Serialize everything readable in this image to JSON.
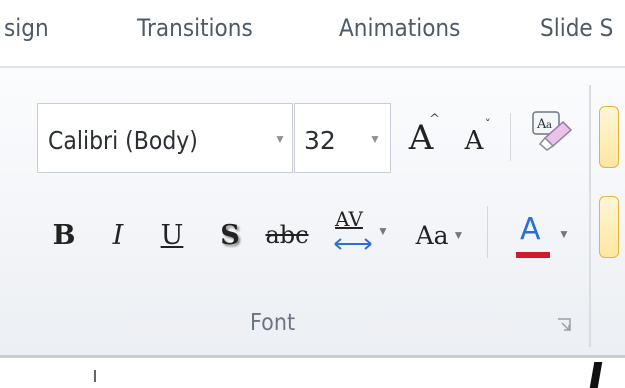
{
  "tabs": [
    {
      "label": "sign"
    },
    {
      "label": "Transitions"
    },
    {
      "label": "Animations"
    },
    {
      "label": "Slide S"
    }
  ],
  "font_group": {
    "font_name": "Calibri (Body)",
    "font_size": "32",
    "grow_label": "A",
    "shrink_label": "A",
    "bold_label": "B",
    "italic_label": "I",
    "underline_label": "U",
    "shadow_label": "S",
    "strike_label": "abc",
    "spacing_label": "AV",
    "case_label": "Aa",
    "color_label": "A",
    "group_label": "Font",
    "clear_format_label": "A"
  },
  "colors": {
    "font_color_swatch": "#d11a2a",
    "spacing_arrow": "#2a6fd1",
    "peek_border": "#e2b53c"
  },
  "icons": [
    "dropdown-arrow-icon",
    "grow-font-icon",
    "shrink-font-icon",
    "clear-formatting-icon",
    "character-spacing-icon",
    "dialog-launcher-icon"
  ]
}
